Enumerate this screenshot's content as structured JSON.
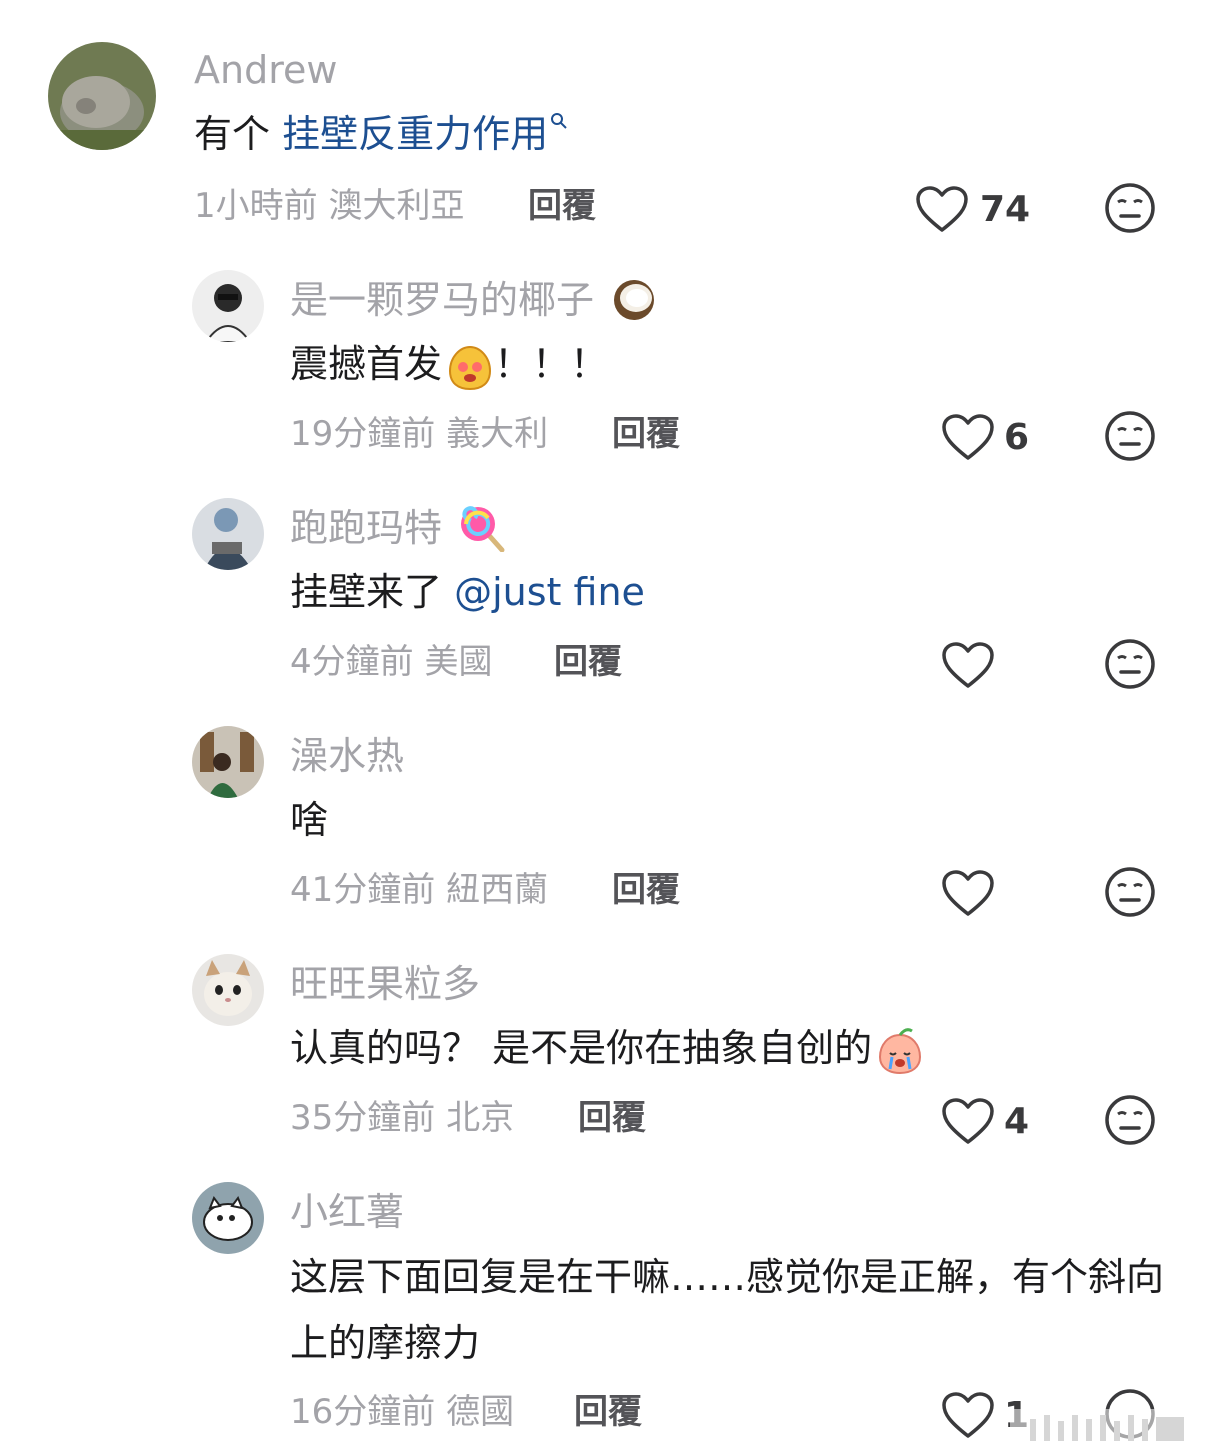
{
  "comments": [
    {
      "username": "Andrew",
      "text_plain": "有个 ",
      "text_link": "挂壁反重力作用",
      "time": "1小時前",
      "location": "澳大利亞",
      "reply": "回覆",
      "likes": "74"
    },
    {
      "username": "是一颗罗马的椰子",
      "text_plain": "震撼首发",
      "text_after": "！！！",
      "time": "19分鐘前",
      "location": "義大利",
      "reply": "回覆",
      "likes": "6"
    },
    {
      "username": "跑跑玛特",
      "text_plain": "挂壁来了 ",
      "text_link": "@just fine",
      "time": "4分鐘前",
      "location": "美國",
      "reply": "回覆",
      "likes": ""
    },
    {
      "username": "澡水热",
      "text_plain": "啥",
      "time": "41分鐘前",
      "location": "紐西蘭",
      "reply": "回覆",
      "likes": ""
    },
    {
      "username": "旺旺果粒多",
      "text_plain": "认真的吗？  是不是你在抽象自创的",
      "time": "35分鐘前",
      "location": "北京",
      "reply": "回覆",
      "likes": "4"
    },
    {
      "username": "小红薯",
      "text_plain": "这层下面回复是在干嘛……感觉你是正解，有个斜向上的摩擦力",
      "time": "16分鐘前",
      "location": "德國",
      "reply": "回覆",
      "likes": "1"
    }
  ],
  "icons": {
    "like": "heart-outline-icon",
    "reaction": "neutral-face-icon",
    "search": "search-icon"
  },
  "colors": {
    "link": "#1d4f91",
    "muted": "#a3a3a8",
    "text": "#1c1c1e"
  }
}
